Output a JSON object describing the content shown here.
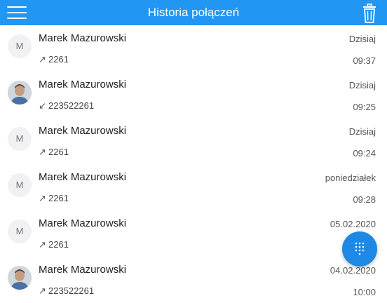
{
  "header": {
    "title": "Historia połączeń",
    "menu_icon": "hamburger-menu-icon",
    "trash_icon": "trash-icon",
    "color": "#2196F3"
  },
  "calls": [
    {
      "name": "Marek Mazurowski",
      "initial": "M",
      "avatar": "initial",
      "direction": "outgoing",
      "arrow": "↗",
      "number": "2261",
      "day": "Dzisiaj",
      "time": "09:37"
    },
    {
      "name": "Marek Mazurowski",
      "initial": "",
      "avatar": "photo",
      "direction": "incoming",
      "arrow": "↙",
      "number": "223522261",
      "day": "Dzisiaj",
      "time": "09:25"
    },
    {
      "name": "Marek Mazurowski",
      "initial": "M",
      "avatar": "initial",
      "direction": "outgoing",
      "arrow": "↗",
      "number": "2261",
      "day": "Dzisiaj",
      "time": "09:24"
    },
    {
      "name": "Marek Mazurowski",
      "initial": "M",
      "avatar": "initial",
      "direction": "outgoing",
      "arrow": "↗",
      "number": "2261",
      "day": "poniedziałek",
      "time": "09:28"
    },
    {
      "name": "Marek Mazurowski",
      "initial": "M",
      "avatar": "initial",
      "direction": "outgoing",
      "arrow": "↗",
      "number": "2261",
      "day": "05.02.2020",
      "time": ""
    },
    {
      "name": "Marek Mazurowski",
      "initial": "",
      "avatar": "photo",
      "direction": "outgoing",
      "arrow": "↗",
      "number": "223522261",
      "day": "04.02.2020",
      "time": "10:00"
    }
  ],
  "fab": {
    "icon": "dialpad-icon",
    "color": "#1E88E5"
  }
}
